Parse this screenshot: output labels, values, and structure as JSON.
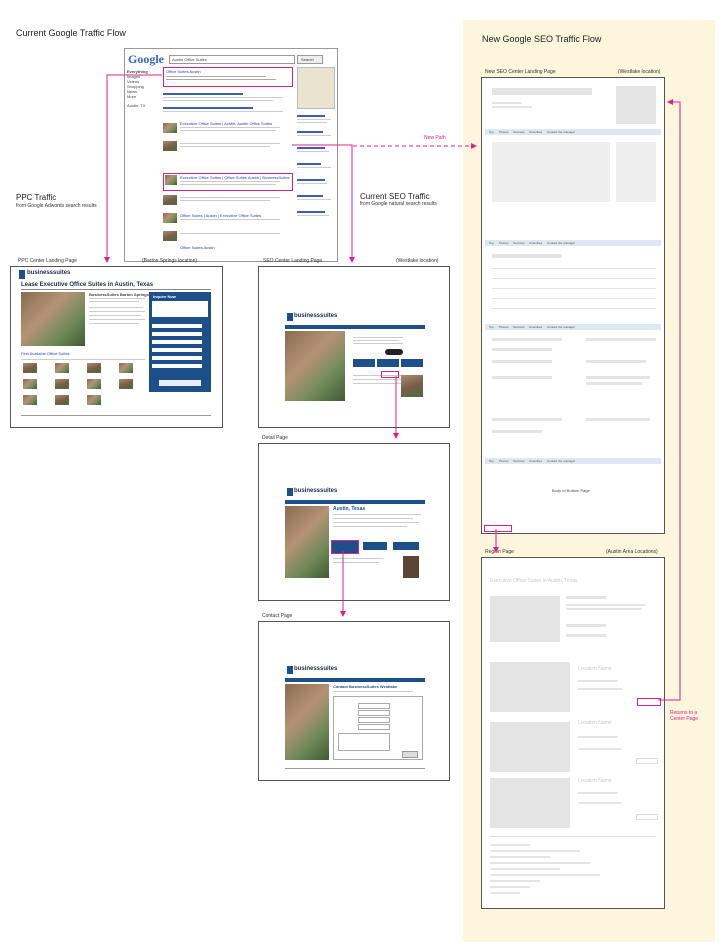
{
  "colors": {
    "accent_pink": "#e0208a",
    "brand_blue": "#1d4f8a",
    "panel_yellow": "#fdf6dc"
  },
  "left_title": "Current Google Traffic Flow",
  "right_title": "New Google SEO Traffic Flow",
  "ppc_traffic": {
    "title": "PPC Traffic",
    "subtitle": "from Google Adwords search results"
  },
  "seo_traffic": {
    "title": "Current SEO Traffic",
    "subtitle": "from Google natural search results"
  },
  "new_path": "New Path",
  "google": {
    "logo": "Google",
    "query": "Austin Office Suites",
    "search_button": "Search",
    "sidebar_items": [
      "Everything",
      "Images",
      "Videos",
      "Shopping",
      "News",
      "More"
    ],
    "location": "Austin, TX",
    "result_title": "Office Suites Austin",
    "results": [
      "Executive Office Suites | Austin, Austin Office Suites",
      "Executive Office Suites | Office Suites Austin | BusinessSuites",
      "Office Suites | Austin | Executive Office Suites",
      "Office Suites Austin"
    ]
  },
  "ppc_page": {
    "label": "PPC Center Landing Page",
    "location": "(Barton Springs location)",
    "brand": "businesssuites",
    "headline": "Lease Executive Office Suites in Austin, Texas",
    "center_name": "BusinessSuites Barton Springs",
    "form_title": "Inquire Now",
    "link": "Find Available Office Suites"
  },
  "seo_page": {
    "label": "SEO Center Landing Page",
    "location": "(Westlake location)",
    "brand": "businesssuites"
  },
  "detail_page": {
    "label": "Detail Page",
    "brand": "businesssuites",
    "headline": "Austin, Texas"
  },
  "contact_page": {
    "label": "Contact Page",
    "brand": "businesssuites",
    "headline": "Contact BusinessSuites Westlake"
  },
  "new_seo_page": {
    "label": "New SEO Center Landing Page",
    "location": "(Westlake location)",
    "tabs": [
      "Top",
      "Photos",
      "Services",
      "Amenities",
      "Contact the manager"
    ],
    "tabs2": [
      "Top",
      "Photos",
      "Services",
      "Amenities",
      "Contact the manager"
    ],
    "tabs3": [
      "Top",
      "Photos",
      "Services",
      "Amenities",
      "Contact the manager"
    ],
    "tabs4": [
      "Top",
      "Photos",
      "Services",
      "Amenities",
      "Contact the manager"
    ],
    "footer_note": "Body of Bottom Page"
  },
  "region_page": {
    "label": "Region Page",
    "location": "(Austin Area Locations)",
    "title": "Executive Office Suites in Austin, Texas",
    "locations": [
      "Location Name",
      "Location Name",
      "Location Name"
    ],
    "returns_note": "Returns to a Center Page"
  }
}
